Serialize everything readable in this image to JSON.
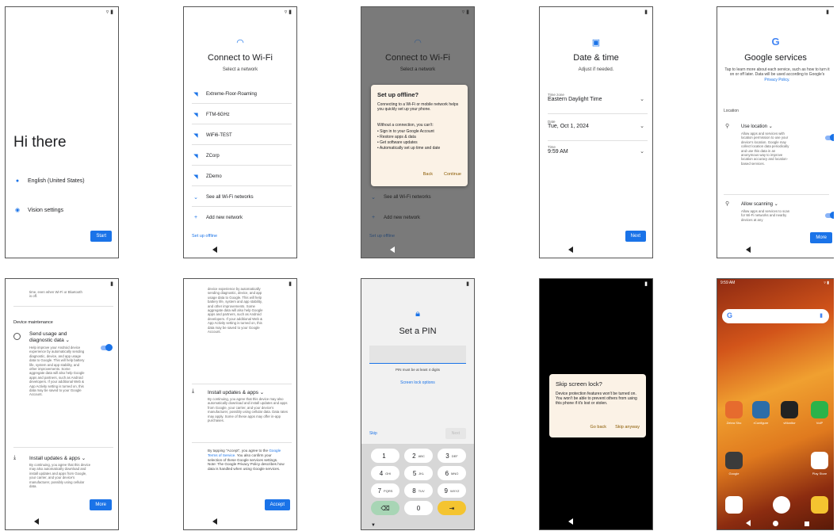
{
  "s1": {
    "greeting": "Hi there",
    "language": "English (United States)",
    "vision": "Vision settings",
    "start": "Start"
  },
  "s2": {
    "title": "Connect to Wi-Fi",
    "subtitle": "Select a network",
    "networks": [
      "Extreme-Floor-Roaming",
      "FTM-6GHz",
      "WiFi6-TEST",
      "ZCorp",
      "ZDemo"
    ],
    "see_all": "See all Wi-Fi networks",
    "add": "Add new network",
    "offline": "Set up offline"
  },
  "s3": {
    "title": "Connect to Wi-Fi",
    "subtitle": "Select a network",
    "dialog_title": "Set up offline?",
    "dialog_p1": "Connecting to a Wi-Fi or mobile network helps you quickly set up your phone.",
    "dialog_p2": "Without a connection, you can't:",
    "bullets": [
      "Sign in to your Google Account",
      "Restore apps & data",
      "Get software updates",
      "Automatically set up time and date"
    ],
    "back": "Back",
    "continue": "Continue",
    "see_all": "See all Wi-Fi networks",
    "add": "Add new network",
    "offline": "Set up offline"
  },
  "s4": {
    "title": "Date & time",
    "subtitle": "Adjust if needed.",
    "tz_label": "Time zone",
    "tz_value": "Eastern Daylight Time",
    "date_label": "Date",
    "date_value": "Tue, Oct 1, 2024",
    "time_label": "Time",
    "time_value": "9:59 AM",
    "next": "Next"
  },
  "s5": {
    "title": "Google services",
    "intro": "Tap to learn more about each service, such as how to turn it on or off later. Data will be used according to Google's",
    "policy": "Privacy Policy.",
    "location_header": "Location",
    "use_location": "Use location",
    "use_location_desc": "Allow apps and services with location permission to use your device's location. Google may collect location data periodically and use this data in an anonymous way to improve location accuracy and location-based services.",
    "allow_scanning": "Allow scanning",
    "allow_scanning_desc": "Allow apps and services to scan for Wi-Fi networks and nearby devices at any",
    "more": "More"
  },
  "s6": {
    "top_text": "time, even when Wi-Fi or Bluetooth is off.",
    "section": "Device maintenance",
    "send_title": "Send usage and diagnostic data",
    "send_desc": "Help improve your Android device experience by automatically sending diagnostic, device, and app usage data to Google. This will help battery life, system and app stability, and other improvements. Some aggregate data will also help Google apps and partners, such as Android developers. If your additional Web & App Activity setting is turned on, this data may be saved to your Google Account.",
    "install_title": "Install updates & apps",
    "install_desc": "By continuing, you agree that this device may also automatically download and install updates and apps from Google, your carrier, and your device's manufacturer, possibly using cellular data.",
    "more": "More"
  },
  "s7": {
    "top_desc": "device experience by automatically sending diagnostic, device, and app usage data to Google. This will help battery life, system and app stability, and other improvements. Some aggregate data will also help Google apps and partners, such as Android developers. If your additional Web & App Activity setting is turned on, this data may be saved to your Google Account.",
    "install_title": "Install updates & apps",
    "install_desc": "By continuing, you agree that this device may also automatically download and install updates and apps from Google, your carrier, and your device's manufacturer, possibly using cellular data. Data rates may apply. Some of these apps may offer in-app purchases.",
    "tos_pre": "By tapping \"Accept\", you agree to the",
    "tos_link": "Google Terms of Service.",
    "tos_post": "You also confirm your selection of these Google services settings. Note: The Google Privacy Policy describes how data is handled when using Google services.",
    "accept": "Accept"
  },
  "s8": {
    "title": "Set a PIN",
    "hint": "PIN must be at least 4 digits",
    "options": "Screen lock options",
    "skip": "Skip",
    "next": "Next",
    "keys": [
      {
        "d": "1",
        "s": ""
      },
      {
        "d": "2",
        "s": "ABC"
      },
      {
        "d": "3",
        "s": "DEF"
      },
      {
        "d": "4",
        "s": "GHI"
      },
      {
        "d": "5",
        "s": "JKL"
      },
      {
        "d": "6",
        "s": "MNO"
      },
      {
        "d": "7",
        "s": "PQRS"
      },
      {
        "d": "8",
        "s": "TUV"
      },
      {
        "d": "9",
        "s": "WXYZ"
      },
      {
        "d": "⌫",
        "s": ""
      },
      {
        "d": "0",
        "s": ""
      },
      {
        "d": "⇥",
        "s": ""
      }
    ]
  },
  "s9": {
    "dialog_title": "Skip screen lock?",
    "dialog_body": "Device protection features won't be turned on. You won't be able to prevent others from using this phone if it's lost or stolen.",
    "go_back": "Go back",
    "skip_anyway": "Skip anyway"
  },
  "s10": {
    "time": "9:59 AM",
    "apps": [
      "Zebra Sho",
      "rConfigure",
      "vMonitor",
      "VoIP",
      "Google",
      "Play Store"
    ]
  }
}
